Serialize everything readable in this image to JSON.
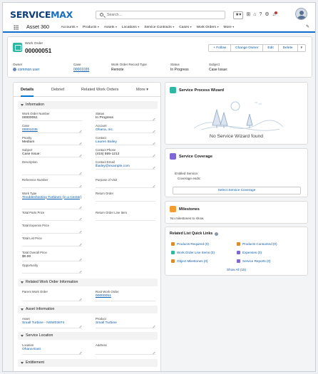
{
  "brand": {
    "name_a": "SERVICE",
    "name_b": "MAX"
  },
  "search": {
    "placeholder": "Search..."
  },
  "nav": {
    "app_name": "Asset 360",
    "items": [
      "Accounts",
      "Products",
      "Assets",
      "Locations",
      "Service Contracts",
      "Cases",
      "Work Orders",
      "More"
    ],
    "active_item": "Work Orders"
  },
  "record": {
    "type_label": "Work Order",
    "title": "00000051",
    "buttons": [
      "+ Follow",
      "Change Owner",
      "Edit",
      "Delete"
    ],
    "highlights": [
      {
        "label": "Owner",
        "value": "common user"
      },
      {
        "label": "Case",
        "value": "00001035"
      },
      {
        "label": "Work Order Record Type",
        "value": "Remote"
      },
      {
        "label": "Status",
        "value": "In Progress"
      },
      {
        "label": "Subject",
        "value": "Case Issue:"
      }
    ]
  },
  "tabs": {
    "items": [
      "Details",
      "Debrief",
      "Related Work Orders",
      "More"
    ],
    "active": "Details"
  },
  "sections": {
    "information": "Information",
    "related_work_order_information": "Related Work Order Information",
    "asset_information": "Asset Information",
    "service_location": "Service Location",
    "entitlement": "Entitlement"
  },
  "fields": {
    "work_order_number": {
      "label": "Work Order Number",
      "value": "00000051"
    },
    "status": {
      "label": "Status",
      "value": "In Progress"
    },
    "case": {
      "label": "Case",
      "value": "00001035"
    },
    "account": {
      "label": "Account",
      "value": "Ohana, Inc."
    },
    "priority": {
      "label": "Priority",
      "value": "Medium"
    },
    "contact": {
      "label": "Contact",
      "value": "Lauren Bailey"
    },
    "subject": {
      "label": "Subject",
      "value": "Case Issue:"
    },
    "contact_phone": {
      "label": "Contact Phone",
      "value": "(415) 555-1212"
    },
    "description": {
      "label": "Description",
      "value": ""
    },
    "contact_email": {
      "label": "Contact Email",
      "value": "lbailey@example.com"
    },
    "reference_number": {
      "label": "Reference Number",
      "value": ""
    },
    "purpose_of_visit": {
      "label": "Purpose of Visit",
      "value": ""
    },
    "work_type": {
      "label": "Work Type",
      "value": "Troubleshooting Turbines (in a Center)"
    },
    "return_order": {
      "label": "Return Order",
      "value": ""
    },
    "total_parts_price": {
      "label": "Total Parts Price",
      "value": ""
    },
    "return_order_line_item": {
      "label": "Return Order Line Item",
      "value": ""
    },
    "total_expense_price": {
      "label": "Total Expense Price",
      "value": ""
    },
    "total_list_price": {
      "label": "Total List Price",
      "value": ""
    },
    "total_overall_price": {
      "label": "Total Overall Price",
      "value": "$0.00"
    },
    "opportunity": {
      "label": "Opportunity",
      "value": ""
    },
    "parent_work_order": {
      "label": "Parent Work Order",
      "value": ""
    },
    "root_work_order": {
      "label": "Root Work Order",
      "value": "00000051"
    },
    "asset": {
      "label": "Asset",
      "value": "Small Turbine - NSW03674"
    },
    "product": {
      "label": "Product",
      "value": "Small Turbine"
    },
    "location": {
      "label": "Location",
      "value": "Ohana East"
    },
    "address": {
      "label": "Address",
      "value": ""
    }
  },
  "wizard": {
    "title": "Service Process Wizard",
    "message": "No Service Wizard found"
  },
  "coverage": {
    "title": "Service Coverage",
    "entitled_service_label": "Entitled Service:",
    "coverage_ends_label": "Coverage ends:",
    "button": "Select Service Coverage"
  },
  "milestones": {
    "title": "Milestones",
    "message": "No milestones to show."
  },
  "quick_links": {
    "title": "Related List Quick Links",
    "items": [
      {
        "label": "Products Required (0)",
        "color": "#dc8b2c"
      },
      {
        "label": "Products Consumed (0)",
        "color": "#dc8b2c"
      },
      {
        "label": "Work Order Line Items (0)",
        "color": "#2fb7a3"
      },
      {
        "label": "Expenses (0)",
        "color": "#7f67d6"
      },
      {
        "label": "Object Milestones (0)",
        "color": "#dc8b2c"
      },
      {
        "label": "Service Reports (0)",
        "color": "#7f67d6"
      }
    ],
    "show_all": "Show All (15)"
  },
  "colors": {
    "brand_blue": "#0f6ecd",
    "link": "#0b5cab",
    "teal": "#2fb7a3",
    "purple": "#7f67d6",
    "orange": "#f59c31"
  }
}
